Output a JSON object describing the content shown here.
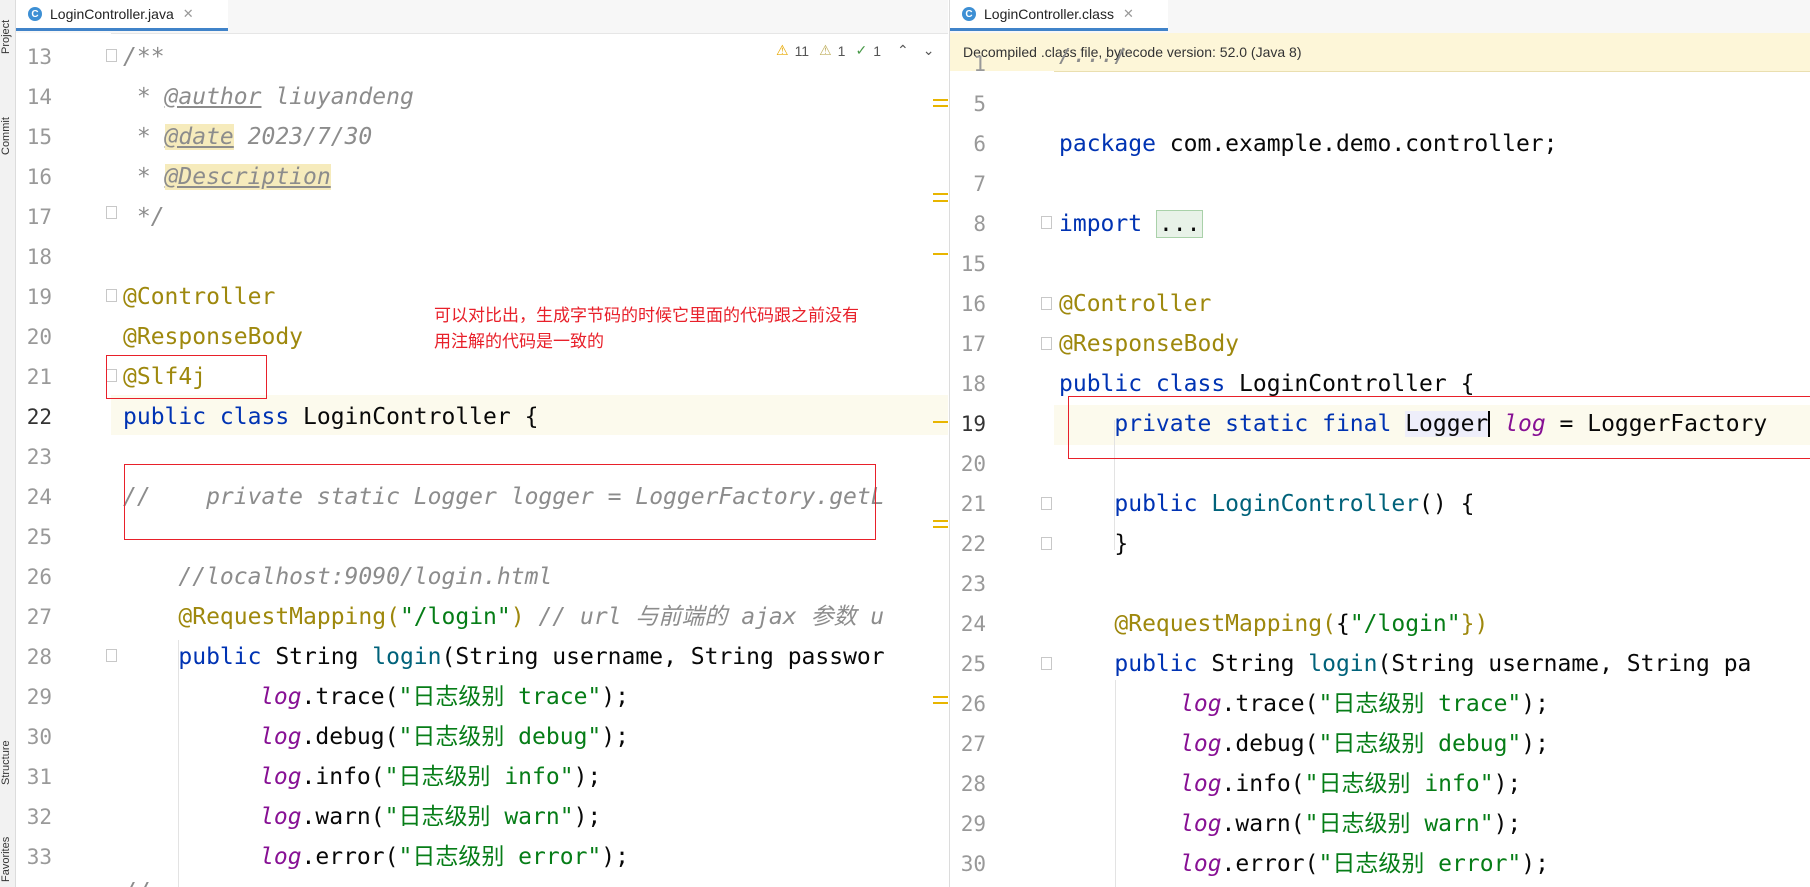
{
  "side_tools": {
    "project": "Project",
    "commit": "Commit",
    "structure": "Structure",
    "favorites": "Favorites"
  },
  "left": {
    "tab_icon": "C",
    "tab_title": "LoginController.java",
    "inspection": {
      "warnings": "11",
      "weak_warnings": "1",
      "typos": "1"
    },
    "note_line1": "可以对比出，生成字节码的时候它里面的代码跟之前没有",
    "note_line2": "用注解的代码是一致的",
    "line_numbers": [
      "13",
      "14",
      "15",
      "16",
      "17",
      "18",
      "19",
      "20",
      "21",
      "22",
      "23",
      "24",
      "25",
      "26",
      "27",
      "28",
      "29",
      "30",
      "31",
      "32",
      "33"
    ],
    "code": {
      "c13": "/**",
      "c14a": " * ",
      "c14tag": "@author",
      "c14b": " liuyandeng",
      "c15a": " * ",
      "c15tag": "@date",
      "c15b": " 2023/7/30",
      "c16a": " * ",
      "c16tag": "@Description",
      "c17": " */",
      "c19": "@Controller",
      "c20": "@ResponseBody",
      "c21": "@Slf4j",
      "c22kw": "public class ",
      "c22b": "LoginController {",
      "c24": "//    private static Logger logger = LoggerFactory.getL",
      "c26": "    //localhost:9090/login.html",
      "c27ann": "    @RequestMapping(",
      "c27str": "\"/login\"",
      "c27b": ")",
      "c27cmt": " // url 与前端的 ajax 参数 u",
      "c28kw": "    public ",
      "c28b": "String ",
      "c28m": "login",
      "c28c": "(String username, String passwor",
      "c29log": "log",
      "c29a": ".trace(",
      "c29str": "\"日志级别 trace\"",
      "c29b": ");",
      "c30log": "log",
      "c30a": ".debug(",
      "c30str": "\"日志级别 debug\"",
      "c30b": ");",
      "c31log": "log",
      "c31a": ".info(",
      "c31str": "\"日志级别 info\"",
      "c31b": ");",
      "c32log": "log",
      "c32a": ".warn(",
      "c32str": "\"日志级别 warn\"",
      "c32b": ");",
      "c33log": "log",
      "c33a": ".error(",
      "c33str": "\"日志级别 error\"",
      "c33b": ");",
      "c34": "//"
    }
  },
  "right": {
    "tab_icon": "C",
    "tab_title": "LoginController.class",
    "banner": "Decompiled .class file, bytecode version: 52.0 (Java 8)",
    "line_numbers": [
      "1",
      "5",
      "6",
      "7",
      "8",
      "15",
      "16",
      "17",
      "18",
      "19",
      "20",
      "21",
      "22",
      "23",
      "24",
      "25",
      "26",
      "27",
      "28",
      "29",
      "30"
    ],
    "code": {
      "c1": "/.../",
      "c6kw": "package ",
      "c6b": "com.example.demo.controller;",
      "c8kw": "import ",
      "c8b": "...",
      "c16": "@Controller",
      "c17": "@ResponseBody",
      "c18kw": "public class ",
      "c18b": "LoginController {",
      "c19kw": "    private static final ",
      "c19b": "Logger",
      "c19log": "log",
      "c19c": " = LoggerFactory",
      "c21kw": "    public ",
      "c21m": "LoginController",
      "c21b": "() {",
      "c22": "    }",
      "c24ann": "    @RequestMapping(",
      "c24b": "{",
      "c24str": "\"/login\"",
      "c24c": "})",
      "c25kw": "    public ",
      "c25b": "String ",
      "c25m": "login",
      "c25c": "(String username, String pa",
      "c26log": "log",
      "c26a": ".trace(",
      "c26str": "\"日志级别 trace\"",
      "c26b": ");",
      "c27log": "log",
      "c27a": ".debug(",
      "c27str": "\"日志级别 debug\"",
      "c27b": ");",
      "c28log": "log",
      "c28a": ".info(",
      "c28str": "\"日志级别 info\"",
      "c28b": ");",
      "c29log": "log",
      "c29a": ".warn(",
      "c29str": "\"日志级别 warn\"",
      "c29b": ");",
      "c30log": "log",
      "c30a": ".error(",
      "c30str": "\"日志级别 error\"",
      "c30b": ");"
    }
  }
}
